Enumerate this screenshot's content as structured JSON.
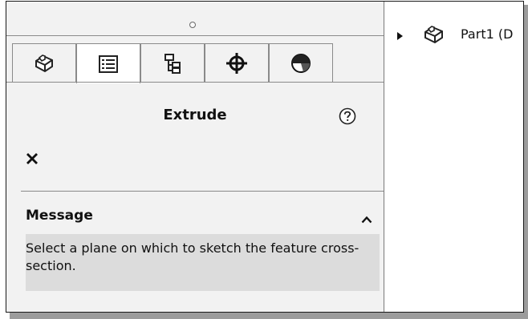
{
  "property_manager": {
    "tabs": [
      {
        "icon": "part-features-icon",
        "active": false
      },
      {
        "icon": "property-manager-icon",
        "active": true
      },
      {
        "icon": "configuration-manager-icon",
        "active": false
      },
      {
        "icon": "dimxpert-icon",
        "active": false
      },
      {
        "icon": "display-manager-icon",
        "active": false
      }
    ],
    "title": "Extrude",
    "help_icon": "help-icon",
    "close_icon": "close-icon",
    "message_section": {
      "heading": "Message",
      "collapse_icon": "chevron-up-icon",
      "text": "Select a plane on which to sketch the feature cross-section."
    }
  },
  "feature_tree": {
    "root_label": "Part1 (D"
  }
}
